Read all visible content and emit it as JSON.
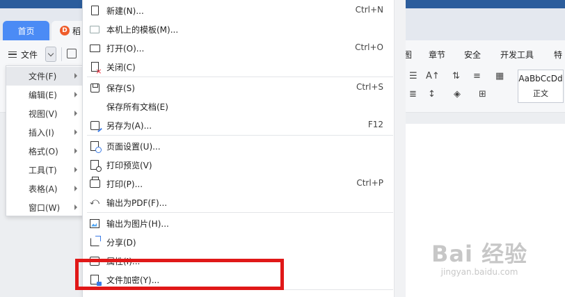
{
  "tabs": {
    "home_label": "首页",
    "doc_label": "稻"
  },
  "toolbar": {
    "file_label": "文件"
  },
  "ribbon": {
    "tabs": [
      "图",
      "章节",
      "安全",
      "开发工具",
      "特"
    ],
    "style_sample": "AaBbCcDd",
    "style_name": "正文"
  },
  "left_menu": {
    "items": [
      {
        "label": "文件(F)",
        "active": true
      },
      {
        "label": "编辑(E)",
        "active": false
      },
      {
        "label": "视图(V)",
        "active": false
      },
      {
        "label": "插入(I)",
        "active": false
      },
      {
        "label": "格式(O)",
        "active": false
      },
      {
        "label": "工具(T)",
        "active": false
      },
      {
        "label": "表格(A)",
        "active": false
      },
      {
        "label": "窗口(W)",
        "active": false
      }
    ]
  },
  "file_menu": {
    "items": [
      {
        "label": "新建(N)...",
        "shortcut": "Ctrl+N",
        "icon": "new-document-icon"
      },
      {
        "label": "本机上的模板(M)...",
        "shortcut": "",
        "icon": "template-icon"
      },
      {
        "label": "打开(O)...",
        "shortcut": "Ctrl+O",
        "icon": "open-folder-icon"
      },
      {
        "label": "关闭(C)",
        "shortcut": "",
        "icon": "close-document-icon"
      },
      {
        "label": "保存(S)",
        "shortcut": "Ctrl+S",
        "icon": "save-icon"
      },
      {
        "label": "保存所有文档(E)",
        "shortcut": "",
        "icon": ""
      },
      {
        "label": "另存为(A)...",
        "shortcut": "F12",
        "icon": "save-as-icon"
      },
      {
        "label": "页面设置(U)...",
        "shortcut": "",
        "icon": "page-setup-icon"
      },
      {
        "label": "打印预览(V)",
        "shortcut": "",
        "icon": "print-preview-icon"
      },
      {
        "label": "打印(P)...",
        "shortcut": "Ctrl+P",
        "icon": "print-icon"
      },
      {
        "label": "输出为PDF(F)...",
        "shortcut": "",
        "icon": "export-pdf-icon"
      },
      {
        "label": "输出为图片(H)...",
        "shortcut": "",
        "icon": "export-image-icon"
      },
      {
        "label": "分享(D)",
        "shortcut": "",
        "icon": "share-icon"
      },
      {
        "label": "属性(I)...",
        "shortcut": "",
        "icon": "properties-icon"
      },
      {
        "label": "文件加密(Y)...",
        "shortcut": "",
        "icon": "encrypt-icon"
      }
    ]
  },
  "watermark": {
    "brand": "Bai 经验",
    "url": "jingyan.baidu.com"
  },
  "colors": {
    "accent_blue": "#4b8bf5",
    "highlight_red": "#e01818"
  }
}
